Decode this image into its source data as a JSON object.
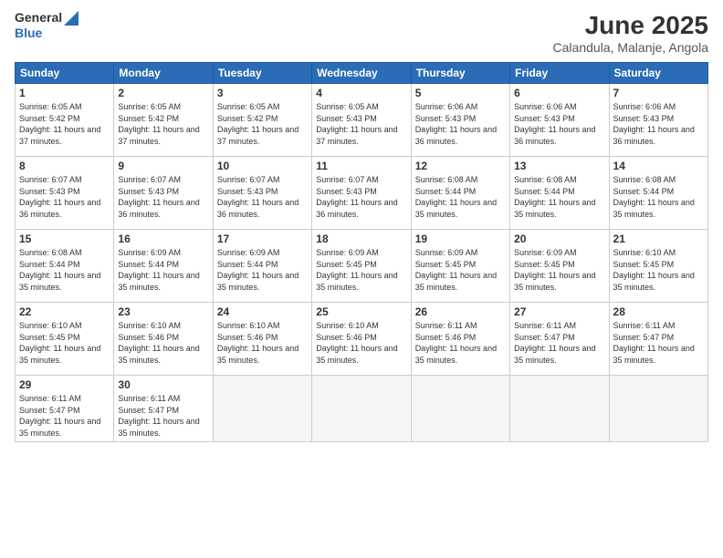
{
  "header": {
    "logo_general": "General",
    "logo_blue": "Blue",
    "title": "June 2025",
    "subtitle": "Calandula, Malanje, Angola"
  },
  "calendar": {
    "days_of_week": [
      "Sunday",
      "Monday",
      "Tuesday",
      "Wednesday",
      "Thursday",
      "Friday",
      "Saturday"
    ],
    "weeks": [
      [
        {
          "day": "1",
          "sunrise": "6:05 AM",
          "sunset": "5:42 PM",
          "daylight": "11 hours and 37 minutes."
        },
        {
          "day": "2",
          "sunrise": "6:05 AM",
          "sunset": "5:42 PM",
          "daylight": "11 hours and 37 minutes."
        },
        {
          "day": "3",
          "sunrise": "6:05 AM",
          "sunset": "5:42 PM",
          "daylight": "11 hours and 37 minutes."
        },
        {
          "day": "4",
          "sunrise": "6:05 AM",
          "sunset": "5:43 PM",
          "daylight": "11 hours and 37 minutes."
        },
        {
          "day": "5",
          "sunrise": "6:06 AM",
          "sunset": "5:43 PM",
          "daylight": "11 hours and 36 minutes."
        },
        {
          "day": "6",
          "sunrise": "6:06 AM",
          "sunset": "5:43 PM",
          "daylight": "11 hours and 36 minutes."
        },
        {
          "day": "7",
          "sunrise": "6:06 AM",
          "sunset": "5:43 PM",
          "daylight": "11 hours and 36 minutes."
        }
      ],
      [
        {
          "day": "8",
          "sunrise": "6:07 AM",
          "sunset": "5:43 PM",
          "daylight": "11 hours and 36 minutes."
        },
        {
          "day": "9",
          "sunrise": "6:07 AM",
          "sunset": "5:43 PM",
          "daylight": "11 hours and 36 minutes."
        },
        {
          "day": "10",
          "sunrise": "6:07 AM",
          "sunset": "5:43 PM",
          "daylight": "11 hours and 36 minutes."
        },
        {
          "day": "11",
          "sunrise": "6:07 AM",
          "sunset": "5:43 PM",
          "daylight": "11 hours and 36 minutes."
        },
        {
          "day": "12",
          "sunrise": "6:08 AM",
          "sunset": "5:44 PM",
          "daylight": "11 hours and 35 minutes."
        },
        {
          "day": "13",
          "sunrise": "6:08 AM",
          "sunset": "5:44 PM",
          "daylight": "11 hours and 35 minutes."
        },
        {
          "day": "14",
          "sunrise": "6:08 AM",
          "sunset": "5:44 PM",
          "daylight": "11 hours and 35 minutes."
        }
      ],
      [
        {
          "day": "15",
          "sunrise": "6:08 AM",
          "sunset": "5:44 PM",
          "daylight": "11 hours and 35 minutes."
        },
        {
          "day": "16",
          "sunrise": "6:09 AM",
          "sunset": "5:44 PM",
          "daylight": "11 hours and 35 minutes."
        },
        {
          "day": "17",
          "sunrise": "6:09 AM",
          "sunset": "5:44 PM",
          "daylight": "11 hours and 35 minutes."
        },
        {
          "day": "18",
          "sunrise": "6:09 AM",
          "sunset": "5:45 PM",
          "daylight": "11 hours and 35 minutes."
        },
        {
          "day": "19",
          "sunrise": "6:09 AM",
          "sunset": "5:45 PM",
          "daylight": "11 hours and 35 minutes."
        },
        {
          "day": "20",
          "sunrise": "6:09 AM",
          "sunset": "5:45 PM",
          "daylight": "11 hours and 35 minutes."
        },
        {
          "day": "21",
          "sunrise": "6:10 AM",
          "sunset": "5:45 PM",
          "daylight": "11 hours and 35 minutes."
        }
      ],
      [
        {
          "day": "22",
          "sunrise": "6:10 AM",
          "sunset": "5:45 PM",
          "daylight": "11 hours and 35 minutes."
        },
        {
          "day": "23",
          "sunrise": "6:10 AM",
          "sunset": "5:46 PM",
          "daylight": "11 hours and 35 minutes."
        },
        {
          "day": "24",
          "sunrise": "6:10 AM",
          "sunset": "5:46 PM",
          "daylight": "11 hours and 35 minutes."
        },
        {
          "day": "25",
          "sunrise": "6:10 AM",
          "sunset": "5:46 PM",
          "daylight": "11 hours and 35 minutes."
        },
        {
          "day": "26",
          "sunrise": "6:11 AM",
          "sunset": "5:46 PM",
          "daylight": "11 hours and 35 minutes."
        },
        {
          "day": "27",
          "sunrise": "6:11 AM",
          "sunset": "5:47 PM",
          "daylight": "11 hours and 35 minutes."
        },
        {
          "day": "28",
          "sunrise": "6:11 AM",
          "sunset": "5:47 PM",
          "daylight": "11 hours and 35 minutes."
        }
      ],
      [
        {
          "day": "29",
          "sunrise": "6:11 AM",
          "sunset": "5:47 PM",
          "daylight": "11 hours and 35 minutes."
        },
        {
          "day": "30",
          "sunrise": "6:11 AM",
          "sunset": "5:47 PM",
          "daylight": "11 hours and 35 minutes."
        },
        null,
        null,
        null,
        null,
        null
      ]
    ]
  },
  "labels": {
    "sunrise": "Sunrise:",
    "sunset": "Sunset:",
    "daylight": "Daylight:"
  }
}
